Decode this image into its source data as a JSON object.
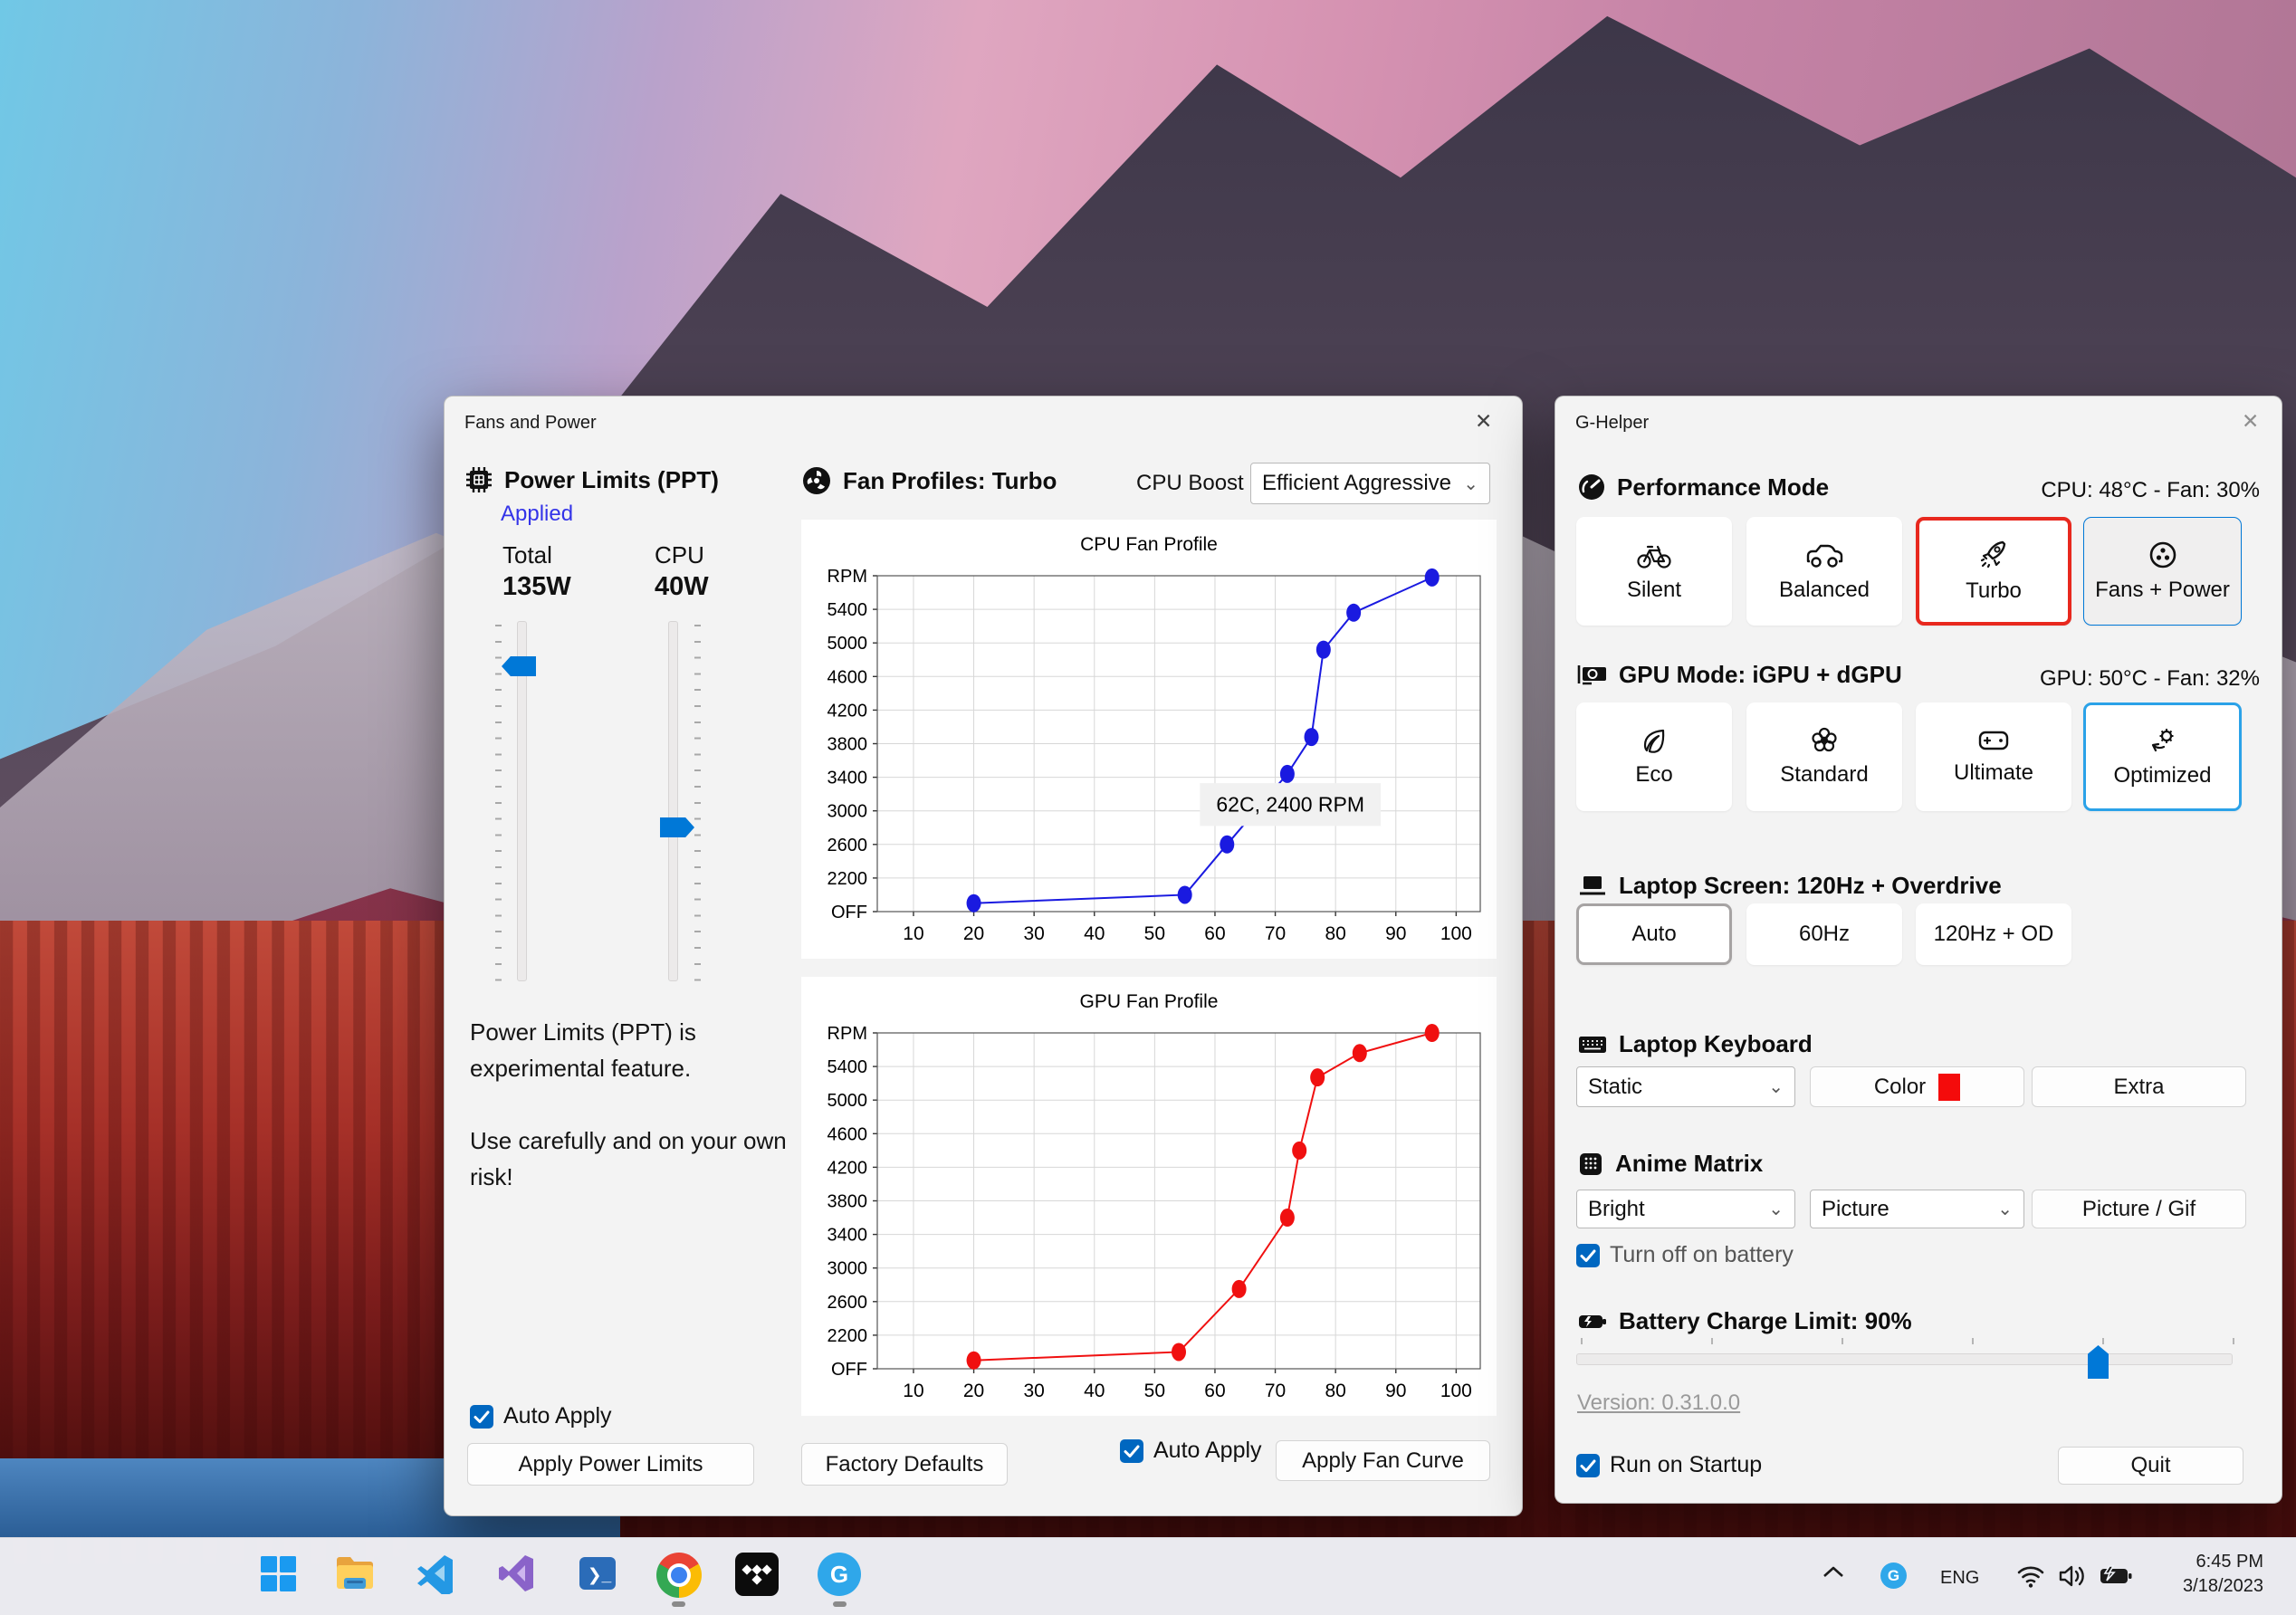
{
  "icons": {
    "close": "✕",
    "dropdown": "⌄"
  },
  "fans_window": {
    "title": "Fans and Power",
    "power_limits": {
      "header": "Power Limits (PPT)",
      "status": "Applied",
      "total_label": "Total",
      "total_value": "135W",
      "cpu_label": "CPU",
      "cpu_value": "40W",
      "warning1": "Power Limits (PPT) is experimental feature.",
      "warning2": "Use carefully and on your own risk!",
      "auto_apply_label": "Auto Apply",
      "apply_button": "Apply Power Limits"
    },
    "fan_profiles": {
      "header": "Fan Profiles: Turbo",
      "cpu_boost_label": "CPU Boost",
      "cpu_boost_value": "Efficient Aggressive",
      "factory_defaults_button": "Factory Defaults",
      "auto_apply_label": "Auto Apply",
      "apply_button": "Apply Fan Curve"
    }
  },
  "chart_data": [
    {
      "type": "line",
      "title": "CPU Fan Profile",
      "color": "#1a1ae0",
      "x": [
        20,
        55,
        62,
        72,
        76,
        78,
        83,
        96
      ],
      "y": [
        1900,
        2000,
        2600,
        3440,
        3880,
        4920,
        5360,
        5780
      ],
      "xlim": [
        4,
        104
      ],
      "xticks": [
        10,
        20,
        30,
        40,
        50,
        60,
        70,
        80,
        90,
        100
      ],
      "ylim": [
        1800,
        5800
      ],
      "yticks": [
        1800,
        2200,
        2600,
        3000,
        3400,
        3800,
        4200,
        4600,
        5000,
        5400,
        5800
      ],
      "ytick_labels": [
        "OFF",
        "2200",
        "2600",
        "3000",
        "3400",
        "3800",
        "4200",
        "4600",
        "5000",
        "5400",
        "RPM"
      ],
      "grid": true,
      "legend": null,
      "tooltip": {
        "text": "62C, 2400 RPM",
        "x1": 57.5,
        "y1": 3330,
        "x2": 87.5,
        "y2": 2820
      }
    },
    {
      "type": "line",
      "title": "GPU Fan Profile",
      "color": "#f01010",
      "x": [
        20,
        54,
        64,
        72,
        74,
        77,
        84,
        96
      ],
      "y": [
        1900,
        2000,
        2750,
        3600,
        4400,
        5270,
        5560,
        5800
      ],
      "xlim": [
        4,
        104
      ],
      "xticks": [
        10,
        20,
        30,
        40,
        50,
        60,
        70,
        80,
        90,
        100
      ],
      "ylim": [
        1800,
        5800
      ],
      "yticks": [
        1800,
        2200,
        2600,
        3000,
        3400,
        3800,
        4200,
        4600,
        5000,
        5400,
        5800
      ],
      "ytick_labels": [
        "OFF",
        "2200",
        "2600",
        "3000",
        "3400",
        "3800",
        "4200",
        "4600",
        "5000",
        "5400",
        "RPM"
      ],
      "grid": true,
      "legend": null,
      "tooltip": null
    }
  ],
  "g_helper": {
    "title": "G-Helper",
    "performance": {
      "header": "Performance Mode",
      "status_right": "CPU: 48°C  -   Fan: 30%",
      "options": [
        {
          "label": "Silent"
        },
        {
          "label": "Balanced"
        },
        {
          "label": "Turbo"
        },
        {
          "label": "Fans + Power"
        }
      ]
    },
    "gpu": {
      "header": "GPU Mode: iGPU + dGPU",
      "status_right": "GPU: 50°C  -   Fan: 32%",
      "options": [
        {
          "label": "Eco"
        },
        {
          "label": "Standard"
        },
        {
          "label": "Ultimate"
        },
        {
          "label": "Optimized"
        }
      ]
    },
    "screen": {
      "header": "Laptop Screen: 120Hz + Overdrive",
      "options": [
        {
          "label": "Auto"
        },
        {
          "label": "60Hz"
        },
        {
          "label": "120Hz + OD"
        }
      ]
    },
    "keyboard": {
      "header": "Laptop Keyboard",
      "mode_value": "Static",
      "color_button": "Color",
      "extra_button": "Extra"
    },
    "anime": {
      "header": "Anime Matrix",
      "brightness_value": "Bright",
      "mode_value": "Picture",
      "picture_button": "Picture / Gif",
      "battery_checkbox": "Turn off on battery"
    },
    "battery": {
      "header": "Battery Charge Limit: 90%",
      "value_percent": 90
    },
    "version": "Version: 0.31.0.0",
    "startup_checkbox": "Run on Startup",
    "quit_button": "Quit"
  },
  "taskbar": {
    "ghelper_letter": "G",
    "terminal_glyph": "❯_",
    "tray": {
      "language": "ENG",
      "time": "6:45 PM",
      "date": "3/18/2023"
    }
  }
}
